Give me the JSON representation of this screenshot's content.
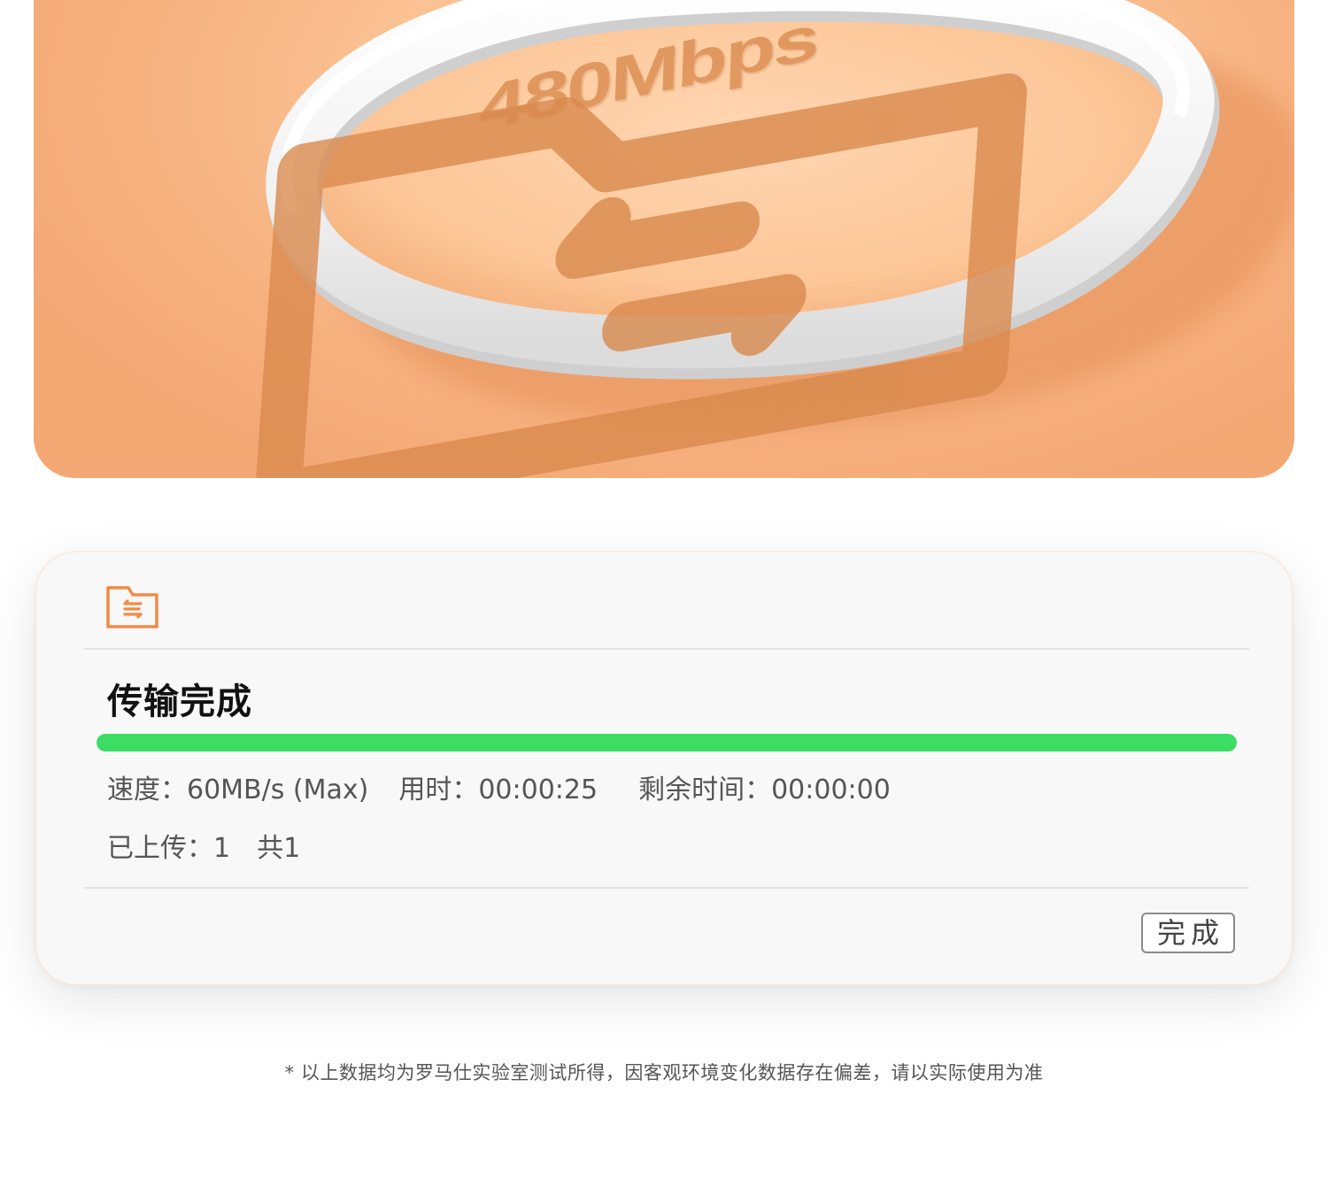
{
  "hero": {
    "speed_label": "480Mbps",
    "background_color": "#f8bd8c",
    "cable_color": "#f4f4f4"
  },
  "dialog": {
    "icon": "folder-transfer-icon",
    "accent_color": "#f28a46",
    "title": "传输完成",
    "progress": {
      "percent": 100,
      "color": "#3ddc62"
    },
    "speed_label": "速度：60MB/s (Max)",
    "elapsed_label": "用时：00:00:25",
    "remaining_label": "剩余时间：00:00:00",
    "uploaded_label": "已上传：1",
    "total_label": "共1",
    "done_button": "完成"
  },
  "footnote": "* 以上数据均为罗马仕实验室测试所得，因客观环境变化数据存在偏差，请以实际使用为准"
}
